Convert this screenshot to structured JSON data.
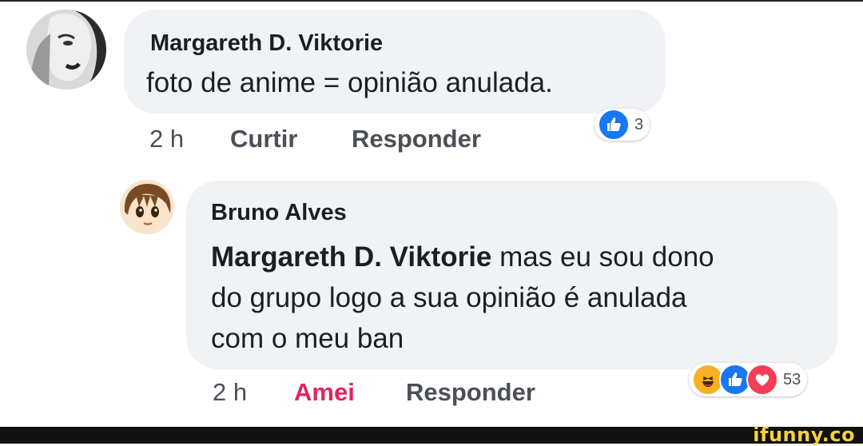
{
  "comments": [
    {
      "author": "Margareth D. Viktorie",
      "text": "foto de anime = opinião anulada.",
      "time": "2 h",
      "action_1": "Curtir",
      "action_2": "Responder",
      "reaction_count": "3",
      "reaction_icons": [
        "like-icon"
      ]
    },
    {
      "author": "Bruno Alves",
      "mention": "Margareth D. Viktorie",
      "text_line1": " mas eu sou dono",
      "text_line2": "do grupo logo a sua opinião é anulada",
      "text_line3": "com o meu ban",
      "time": "2 h",
      "action_1": "Amei",
      "action_2": "Responder",
      "reaction_count": "53",
      "reaction_icons": [
        "haha-icon",
        "like-icon",
        "love-icon"
      ]
    }
  ],
  "watermark": "ifunny.co",
  "colors": {
    "bubble": "#f0f2f5",
    "like_blue": "#1877f2",
    "love_red": "#f33e58",
    "amei_pink": "#e0245e",
    "haha_yellow": "#f7b125"
  }
}
